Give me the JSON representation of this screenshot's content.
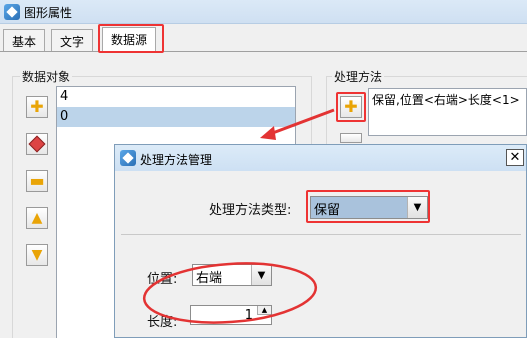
{
  "window": {
    "title": "图形属性"
  },
  "tabs": [
    {
      "label": "基本"
    },
    {
      "label": "文字"
    },
    {
      "label": "数据源"
    }
  ],
  "data_objects": {
    "label": "数据对象",
    "items": [
      "4",
      "0"
    ],
    "selected_index": 1
  },
  "processing": {
    "label": "处理方法",
    "items": [
      "保留,位置<右端>长度<1>"
    ]
  },
  "dialog": {
    "title": "处理方法管理",
    "close_symbol": "✕",
    "type_label": "处理方法类型:",
    "type_value": "保留",
    "position_label": "位置:",
    "position_value": "右端",
    "length_label": "长度:",
    "length_value": "1"
  },
  "colors": {
    "highlight": "#e33333",
    "selection": "#bcd4ea",
    "accent_icon": "#e9a406"
  },
  "icons": [
    "app-icon",
    "add-icon",
    "edit-icon",
    "remove-icon",
    "move-up-icon",
    "move-down-icon",
    "close-icon",
    "dropdown-icon"
  ]
}
